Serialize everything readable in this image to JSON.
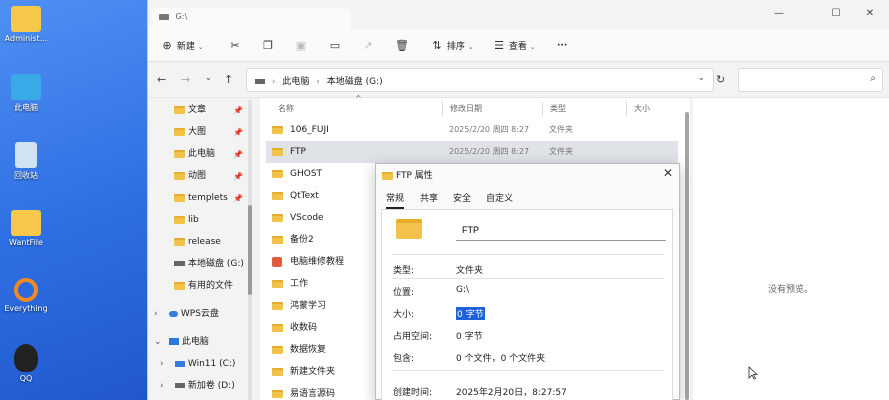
{
  "desktop": {
    "icons": [
      {
        "label": "Administ...",
        "icon": "user-folder-icon",
        "color": "#f5c84c"
      },
      {
        "label": "此电脑",
        "icon": "monitor-icon",
        "color": "#39a9e8"
      },
      {
        "label": "回收站",
        "icon": "recycle-bin-icon",
        "color": "#cfe3f3"
      },
      {
        "label": "WantFile",
        "icon": "folder-icon",
        "color": "#f5c84c"
      },
      {
        "label": "Everything",
        "icon": "everything-icon",
        "color": "#f08a24"
      },
      {
        "label": "QQ",
        "icon": "qq-penguin-icon",
        "color": "#222222"
      }
    ]
  },
  "window": {
    "tab_title": "G:\\",
    "toolbar": {
      "new_label": "新建",
      "sort_label": "排序",
      "view_label": "查看",
      "more_label": "···"
    },
    "address": {
      "path": [
        "此电脑",
        "本地磁盘 (G:)"
      ]
    },
    "sidebar": {
      "items": [
        {
          "label": "文章",
          "pinned": true
        },
        {
          "label": "大图",
          "pinned": true
        },
        {
          "label": "此电脑",
          "pinned": true
        },
        {
          "label": "动图",
          "pinned": true
        },
        {
          "label": "templets",
          "pinned": true
        },
        {
          "label": "lib",
          "pinned": false
        },
        {
          "label": "release",
          "pinned": false
        },
        {
          "label": "本地磁盘 (G:)",
          "pinned": false
        },
        {
          "label": "有用的文件",
          "pinned": false
        }
      ],
      "tree": [
        {
          "label": "WPS云盘",
          "expander": "›"
        },
        {
          "label": "此电脑",
          "expander": "⌄"
        },
        {
          "label": "Win11 (C:)",
          "expander": "›"
        },
        {
          "label": "新加卷 (D:)",
          "expander": "›"
        }
      ]
    },
    "columns": {
      "name": "名称",
      "modified": "修改日期",
      "type": "类型",
      "size": "大小"
    },
    "files": [
      {
        "name": "106_FUJI",
        "modified": "2025/2/20 周四 8:27",
        "type": "文件夹"
      },
      {
        "name": "FTP",
        "modified": "2025/2/20 周四 8:27",
        "type": "文件夹",
        "selected": true
      },
      {
        "name": "GHOST",
        "modified": "",
        "type": ""
      },
      {
        "name": "QtText",
        "modified": "",
        "type": ""
      },
      {
        "name": "VScode",
        "modified": "",
        "type": ""
      },
      {
        "name": "备份2",
        "modified": "",
        "type": ""
      },
      {
        "name": "电脑维修教程",
        "modified": "",
        "type": ""
      },
      {
        "name": "工作",
        "modified": "",
        "type": ""
      },
      {
        "name": "鸿蒙学习",
        "modified": "",
        "type": ""
      },
      {
        "name": "收数码",
        "modified": "",
        "type": ""
      },
      {
        "name": "数据恢复",
        "modified": "",
        "type": ""
      },
      {
        "name": "新建文件夹",
        "modified": "",
        "type": ""
      },
      {
        "name": "易语言源码",
        "modified": "",
        "type": ""
      }
    ],
    "preview_text": "没有预览。"
  },
  "dialog": {
    "title": "FTP 属性",
    "tabs": [
      "常规",
      "共享",
      "安全",
      "自定义"
    ],
    "folder_name": "FTP",
    "props": [
      {
        "label": "类型:",
        "value": "文件夹"
      },
      {
        "label": "位置:",
        "value": "G:\\"
      },
      {
        "label": "大小:",
        "value": "0 字节"
      },
      {
        "label": "占用空间:",
        "value": "0 字节"
      },
      {
        "label": "包含:",
        "value": "0 个文件，0 个文件夹"
      },
      {
        "label": "创建时间:",
        "value": "2025年2月20日，8:27:57"
      }
    ]
  }
}
